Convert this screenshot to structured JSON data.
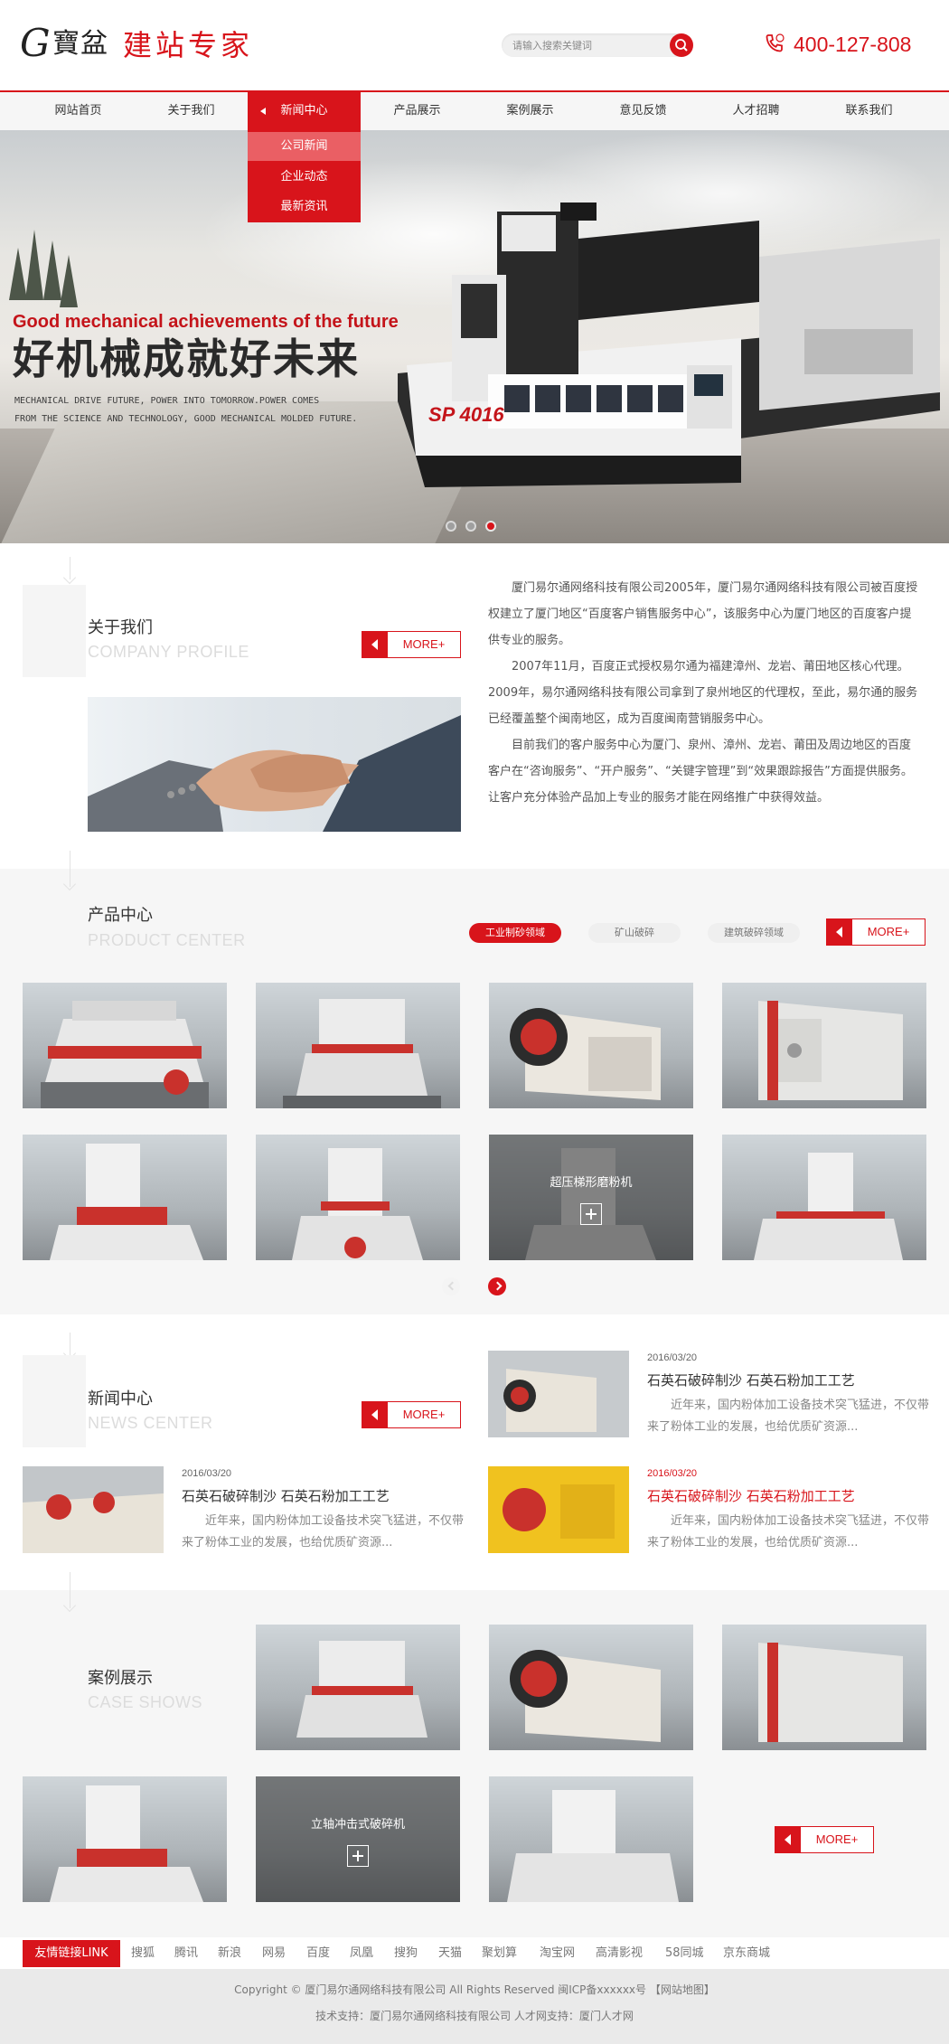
{
  "header": {
    "logo_g": "G",
    "logo_trad": "寶盆",
    "logo_red": "建站专家",
    "search_placeholder": "请输入搜索关键词",
    "phone": "400-127-808"
  },
  "nav": {
    "items": [
      "网站首页",
      "关于我们",
      "新闻中心",
      "产品展示",
      "案例展示",
      "意见反馈",
      "人才招聘",
      "联系我们"
    ],
    "active_index": 2,
    "dropdown": [
      "公司新闻",
      "企业动态",
      "最新资讯"
    ]
  },
  "banner": {
    "en_title": "Good mechanical achievements of the future",
    "zh_title": "好机械成就好未来",
    "sub_line1": "MECHANICAL DRIVE FUTURE, POWER INTO TOMORROW.POWER COMES",
    "sub_line2": "FROM THE SCIENCE AND TECHNOLOGY, GOOD MECHANICAL MOLDED FUTURE.",
    "machine_label": "SP 4016",
    "slides": 3,
    "active_slide": 3
  },
  "about": {
    "title": "关于我们",
    "subtitle": "COMPANY PROFILE",
    "more": "MORE+",
    "paragraphs": [
      "厦门易尔通网络科技有限公司2005年，厦门易尔通网络科技有限公司被百度授权建立了厦门地区“百度客户销售服务中心”，该服务中心为厦门地区的百度客户提供专业的服务。",
      "2007年11月，百度正式授权易尔通为福建漳州、龙岩、莆田地区核心代理。2009年，易尔通网络科技有限公司拿到了泉州地区的代理权，至此，易尔通的服务已经覆盖整个闽南地区，成为百度闽南营销服务中心。",
      "目前我们的客户服务中心为厦门、泉州、漳州、龙岩、莆田及周边地区的百度客户在“咨询服务”、“开户服务”、“关键字管理”到“效果跟踪报告”方面提供服务。让客户充分体验产品加上专业的服务才能在网络推广中获得效益。"
    ]
  },
  "products": {
    "title": "产品中心",
    "subtitle": "PRODUCT CENTER",
    "more": "MORE+",
    "tabs": [
      "工业制砂领域",
      "矿山破碎",
      "建筑破碎领域"
    ],
    "active_tab": 0,
    "hover_caption": "超压梯形磨粉机"
  },
  "news": {
    "title": "新闻中心",
    "subtitle": "NEWS CENTER",
    "more": "MORE+",
    "items": [
      {
        "date": "2016/03/20",
        "title": "石英石破碎制沙 石英石粉加工工艺",
        "desc": "近年来，国内粉体加工设备技术突飞猛进，不仅带来了粉体工业的发展，也给优质矿资源..."
      },
      {
        "date": "2016/03/20",
        "title": "石英石破碎制沙 石英石粉加工工艺",
        "desc": "近年来，国内粉体加工设备技术突飞猛进，不仅带来了粉体工业的发展，也给优质矿资源..."
      },
      {
        "date": "2016/03/20",
        "title": "石英石破碎制沙 石英石粉加工工艺",
        "desc": "近年来，国内粉体加工设备技术突飞猛进，不仅带来了粉体工业的发展，也给优质矿资源..."
      }
    ]
  },
  "cases": {
    "title": "案例展示",
    "subtitle": "CASE SHOWS",
    "more": "MORE+",
    "hover_caption": "立轴冲击式破碎机"
  },
  "links": {
    "label": "友情链接LINK",
    "items": [
      "搜狐",
      "腾讯",
      "新浪",
      "网易",
      "百度",
      "凤凰",
      "搜狗",
      "天猫",
      "聚划算",
      "淘宝网",
      "高清影视",
      "58同城",
      "京东商城"
    ]
  },
  "footer": {
    "line1": "Copyright © 厦门易尔通网络科技有限公司 All Rights Reserved 闽ICP备xxxxxx号 【网站地图】",
    "line2": "技术支持：厦门易尔通网络科技有限公司 人才网支持：厦门人才网"
  },
  "colors": {
    "accent": "#d8141b",
    "nav_bg": "#f6f6f6",
    "footer_bg": "#eaeaea"
  }
}
